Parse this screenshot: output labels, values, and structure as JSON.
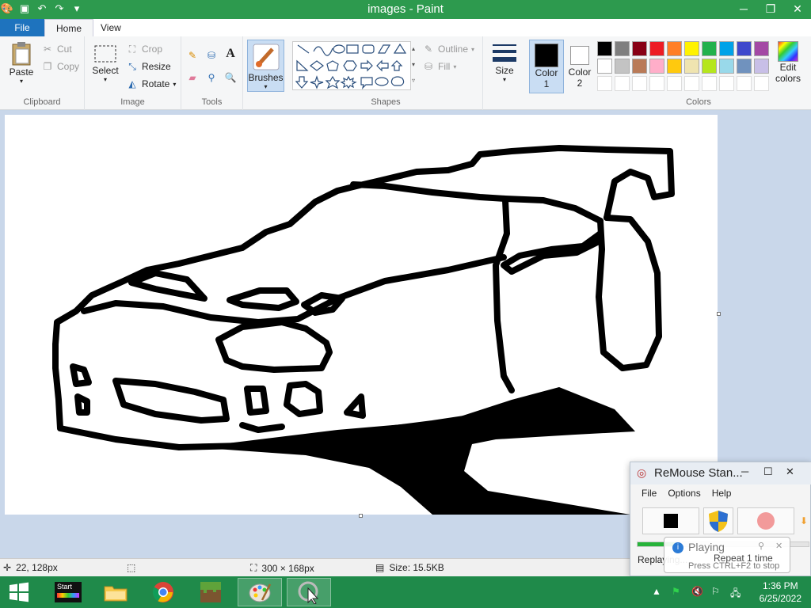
{
  "window": {
    "title": "images - Paint"
  },
  "tabs": {
    "file": "File",
    "home": "Home",
    "view": "View"
  },
  "clipboard": {
    "paste": "Paste",
    "cut": "Cut",
    "copy": "Copy",
    "label": "Clipboard"
  },
  "image": {
    "select": "Select",
    "crop": "Crop",
    "resize": "Resize",
    "rotate": "Rotate",
    "label": "Image"
  },
  "tools": {
    "label": "Tools"
  },
  "brushes": {
    "label": "Brushes"
  },
  "shapes": {
    "outline": "Outline",
    "fill": "Fill",
    "label": "Shapes"
  },
  "size": {
    "label": "Size"
  },
  "color1": {
    "label": "Color",
    "num": "1",
    "value": "#000000"
  },
  "color2": {
    "label": "Color",
    "num": "2",
    "value": "#ffffff"
  },
  "colors": {
    "label": "Colors",
    "edit_line1": "Edit",
    "edit_line2": "colors",
    "palette_row1": [
      "#000000",
      "#7f7f7f",
      "#880015",
      "#ed1c24",
      "#ff7f27",
      "#fff200",
      "#22b14c",
      "#00a2e8",
      "#3f48cc",
      "#a349a4"
    ],
    "palette_row2": [
      "#ffffff",
      "#c3c3c3",
      "#b97a57",
      "#ffaec9",
      "#ffc90e",
      "#efe4b0",
      "#b5e61d",
      "#99d9ea",
      "#7092be",
      "#c8bfe7"
    ]
  },
  "status": {
    "cursor": "22, 128px",
    "dimensions": "300 × 168px",
    "size": "Size: 15.5KB"
  },
  "taskbar": {
    "start_label": "Start",
    "time": "1:36 PM",
    "date": "6/25/2022"
  },
  "remouse": {
    "title": "ReMouse Stan...",
    "menu": [
      "File",
      "Options",
      "Help"
    ],
    "status": "Replaying...",
    "playing": "Playing",
    "repeat": "Repeat 1 time",
    "hint": "Press CTRL+F2 to stop",
    "progress": 0.23
  }
}
